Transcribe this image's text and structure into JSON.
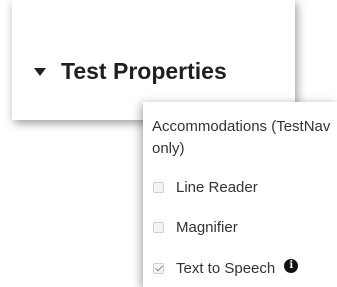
{
  "section": {
    "title": "Test Properties",
    "caret_icon": "caret-down-icon"
  },
  "popover": {
    "title": "Accommodations (TestNav only)",
    "options": [
      {
        "label": "Line Reader",
        "checked": false,
        "disabled": true
      },
      {
        "label": "Magnifier",
        "checked": false,
        "disabled": true
      },
      {
        "label": "Text to Speech",
        "checked": true,
        "disabled": true,
        "info_icon": "info-icon",
        "info_glyph": "i"
      }
    ]
  }
}
